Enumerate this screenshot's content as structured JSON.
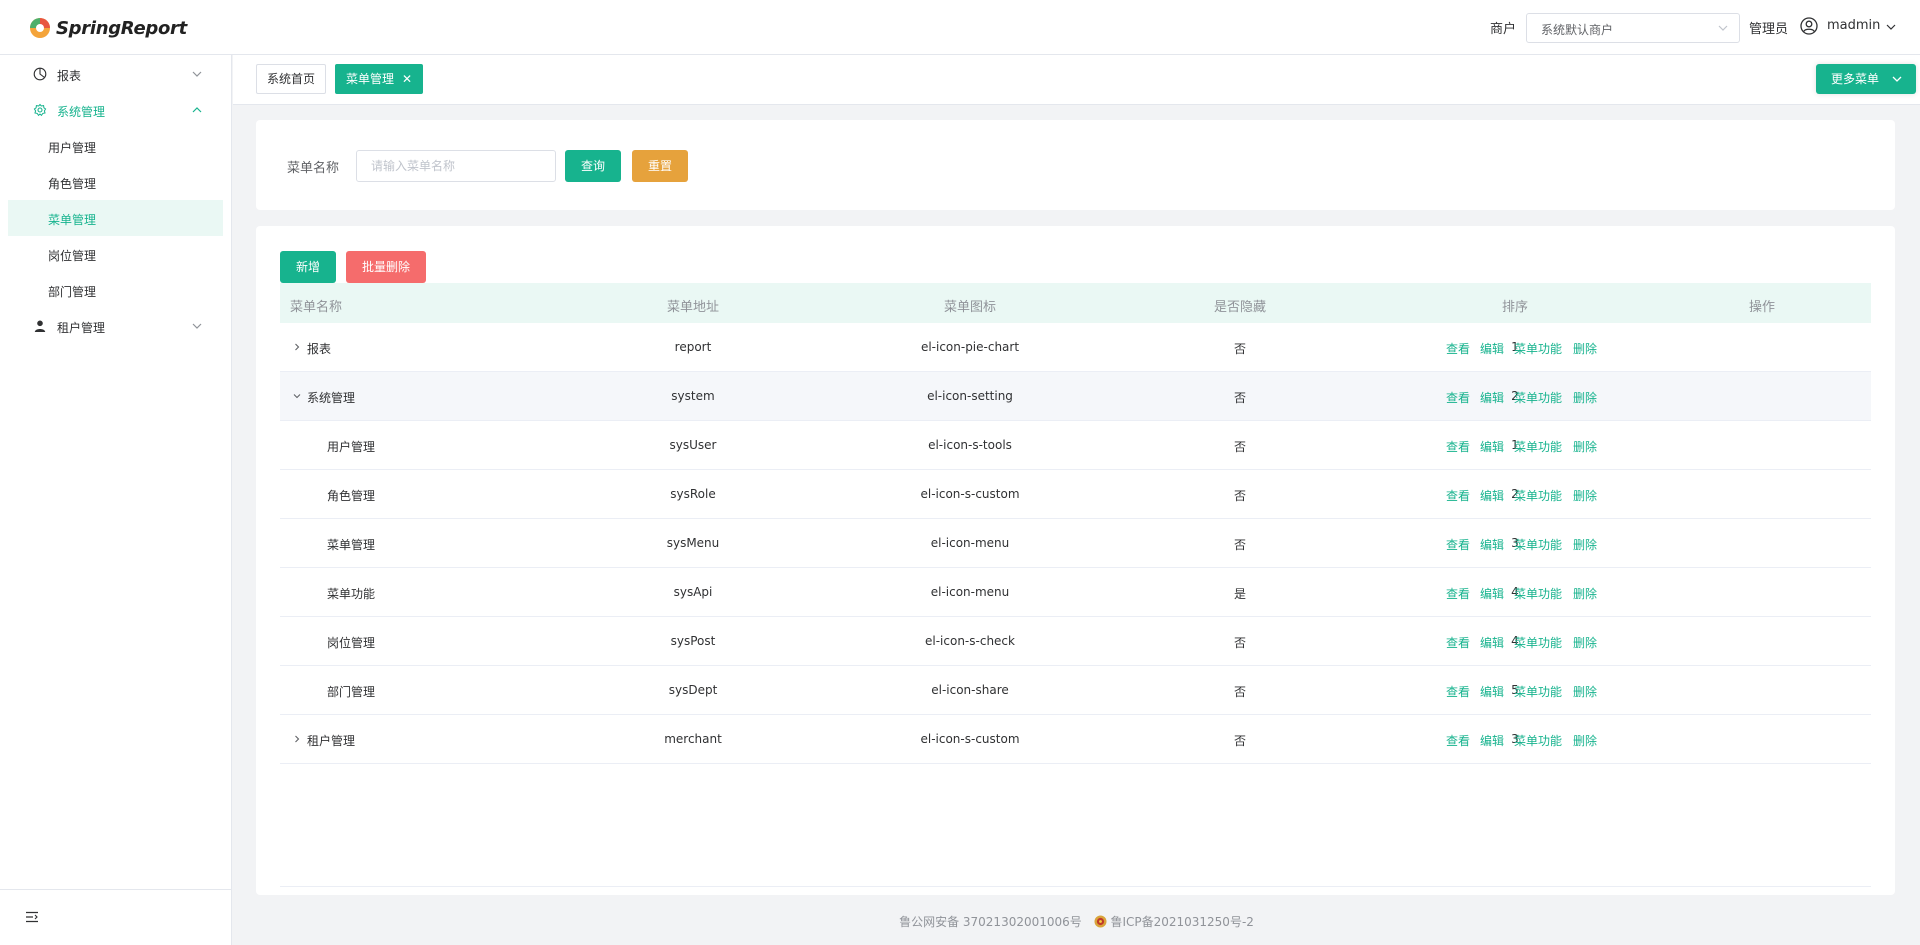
{
  "header": {
    "logo_text": "SpringReport",
    "merchant_label": "商户",
    "merchant_value": "系统默认商户",
    "role_label": "管理员",
    "user_name": "madmin"
  },
  "sidebar": {
    "items": [
      {
        "label": "报表",
        "icon": "pie-chart-icon"
      },
      {
        "label": "系统管理",
        "icon": "setting-icon"
      },
      {
        "label": "租户管理",
        "icon": "user-icon"
      }
    ],
    "sub_items": [
      {
        "label": "用户管理"
      },
      {
        "label": "角色管理"
      },
      {
        "label": "菜单管理"
      },
      {
        "label": "岗位管理"
      },
      {
        "label": "部门管理"
      }
    ]
  },
  "tabs": [
    {
      "label": "系统首页"
    },
    {
      "label": "菜单管理"
    }
  ],
  "more_menu_label": "更多菜单",
  "search": {
    "label": "菜单名称",
    "placeholder": "请输入菜单名称",
    "query_label": "查询",
    "reset_label": "重置"
  },
  "toolbar": {
    "add_label": "新增",
    "batch_delete_label": "批量删除"
  },
  "table": {
    "columns": [
      "菜单名称",
      "菜单地址",
      "菜单图标",
      "是否隐藏",
      "排序",
      "操作"
    ],
    "actions": [
      "查看",
      "编辑",
      "菜单功能",
      "删除"
    ],
    "rows": [
      {
        "name": "报表",
        "url": "report",
        "icon": "el-icon-pie-chart",
        "hidden": "否",
        "sort": "1"
      },
      {
        "name": "系统管理",
        "url": "system",
        "icon": "el-icon-setting",
        "hidden": "否",
        "sort": "2"
      },
      {
        "name": "用户管理",
        "url": "sysUser",
        "icon": "el-icon-s-tools",
        "hidden": "否",
        "sort": "1"
      },
      {
        "name": "角色管理",
        "url": "sysRole",
        "icon": "el-icon-s-custom",
        "hidden": "否",
        "sort": "2"
      },
      {
        "name": "菜单管理",
        "url": "sysMenu",
        "icon": "el-icon-menu",
        "hidden": "否",
        "sort": "3"
      },
      {
        "name": "菜单功能",
        "url": "sysApi",
        "icon": "el-icon-menu",
        "hidden": "是",
        "sort": "4"
      },
      {
        "name": "岗位管理",
        "url": "sysPost",
        "icon": "el-icon-s-check",
        "hidden": "否",
        "sort": "4"
      },
      {
        "name": "部门管理",
        "url": "sysDept",
        "icon": "el-icon-share",
        "hidden": "否",
        "sort": "5"
      },
      {
        "name": "租户管理",
        "url": "merchant",
        "icon": "el-icon-s-custom",
        "hidden": "否",
        "sort": "3"
      }
    ]
  },
  "footer": {
    "police_record": "鲁公网安备 37021302001006号",
    "icp_record": "鲁ICP备2021031250号-2"
  },
  "colors": {
    "accent": "#17b38e",
    "warning": "#e6a23c",
    "danger": "#f56c6c"
  }
}
